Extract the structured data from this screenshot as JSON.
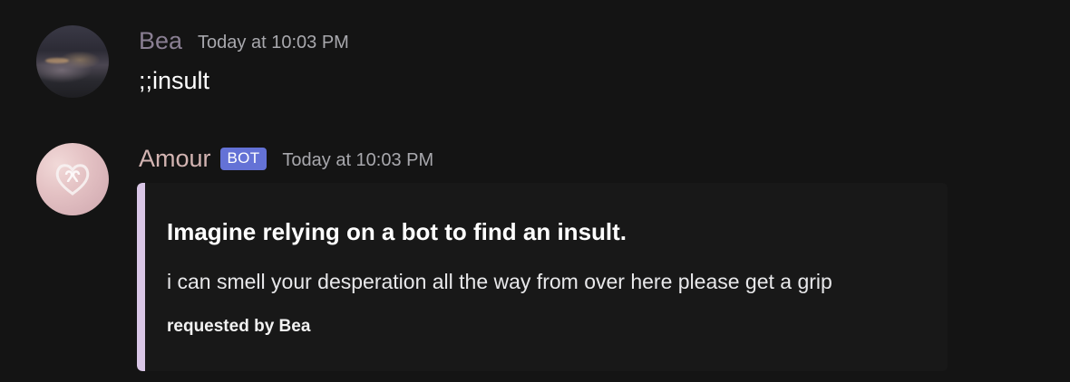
{
  "messages": [
    {
      "author": "Bea",
      "timestamp": "Today at 10:03 PM",
      "content": ";;insult",
      "avatar_icon": "user-avatar-landscape",
      "name_color": "#8a7f93"
    },
    {
      "author": "Amour",
      "is_bot": true,
      "bot_tag": "BOT",
      "timestamp": "Today at 10:03 PM",
      "avatar_icon": "heart-logo-avatar",
      "name_color": "#d3b4b2",
      "embed": {
        "title": "Imagine relying on a bot to find an insult.",
        "description": "i can smell your desperation all the way from over here please get a grip",
        "footer": "requested by Bea",
        "accent_color": "#d9c6e6"
      }
    }
  ],
  "colors": {
    "background": "#141414",
    "embed_background": "#181818",
    "bot_tag": "#6472d6",
    "timestamp": "#a8a8ad"
  }
}
